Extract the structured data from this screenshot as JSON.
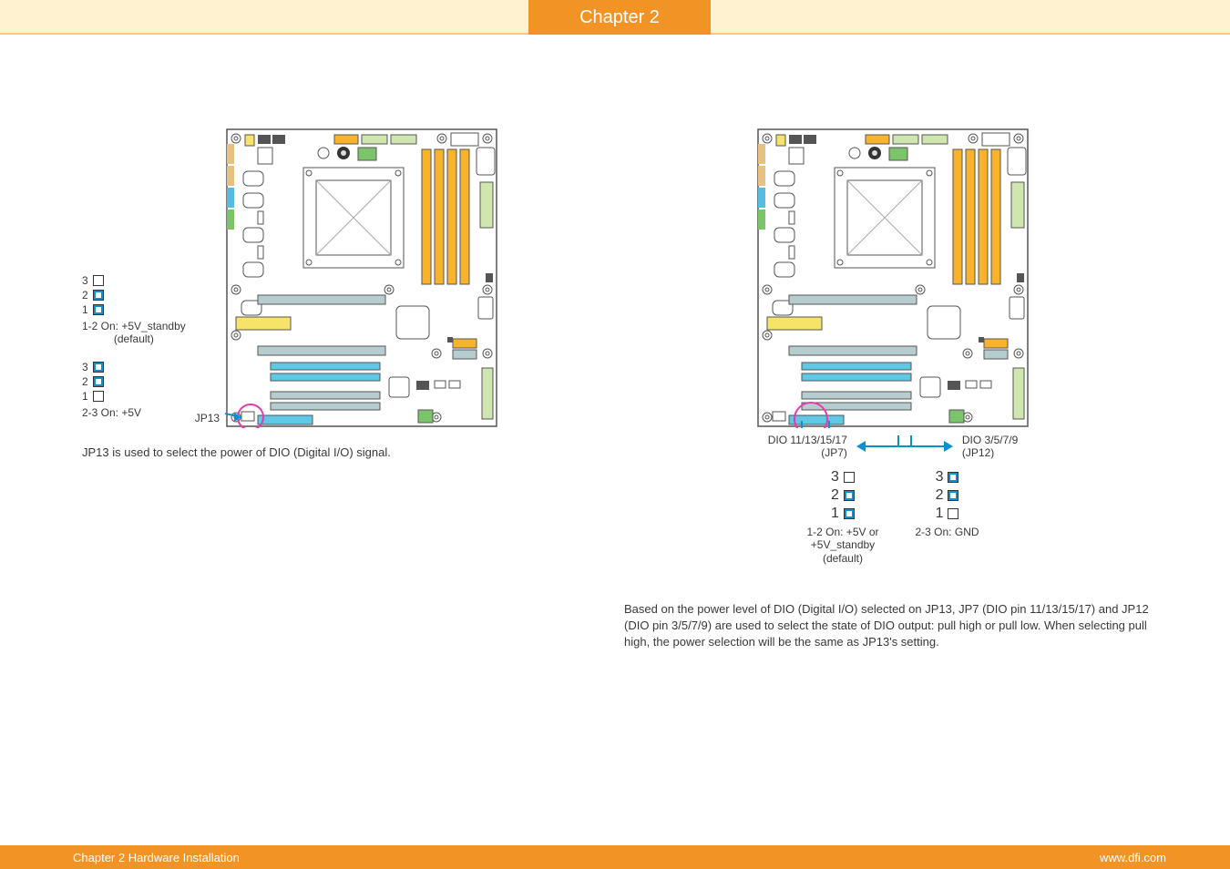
{
  "header": {
    "chapter_tab": "Chapter 2"
  },
  "footer": {
    "left": "Chapter 2 Hardware Installation",
    "right": "www.dfi.com"
  },
  "left_panel": {
    "jumper1": {
      "pins": [
        "3",
        "2",
        "1"
      ],
      "label_line1": "1-2 On: +5V_standby",
      "label_line2": "(default)"
    },
    "jumper2": {
      "pins": [
        "3",
        "2",
        "1"
      ],
      "label": "2-3 On: +5V"
    },
    "jp13_label": "JP13",
    "description": "JP13 is used to select the power of DIO (Digital I/O) signal."
  },
  "right_panel": {
    "callout_left_line1": "DIO 11/13/15/17",
    "callout_left_line2": "(JP7)",
    "callout_right_line1": "DIO 3/5/7/9",
    "callout_right_line2": "(JP12)",
    "jumper1": {
      "pins": [
        "3",
        "2",
        "1"
      ],
      "label_line1": "1-2 On: +5V or",
      "label_line2": "+5V_standby",
      "label_line3": "(default)"
    },
    "jumper2": {
      "pins": [
        "3",
        "2",
        "1"
      ],
      "label": "2-3 On: GND"
    },
    "description": "Based on the power level of DIO (Digital I/O) selected on JP13, JP7 (DIO pin 11/13/15/17) and JP12 (DIO pin 3/5/7/9) are used to select the state of DIO output: pull high or pull low. When selecting pull high, the power selection will be the same as JP13's setting."
  }
}
